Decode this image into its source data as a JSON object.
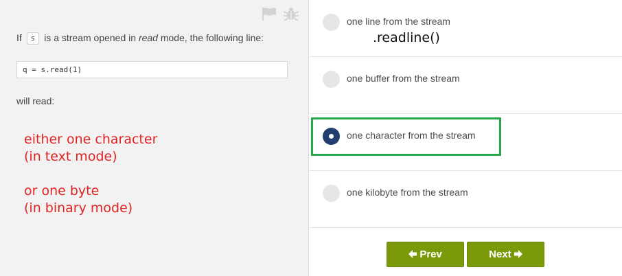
{
  "toolbar": {
    "flag_icon": "flag-icon",
    "bug_icon": "bug-icon"
  },
  "question": {
    "prefix": "If",
    "variable": "s",
    "middle": "is a stream opened in",
    "mode": "read",
    "suffix": "mode, the following line:",
    "code": "q = s.read(1)",
    "will_read": "will read:"
  },
  "annotations": {
    "note_1_line_1": "either one character",
    "note_1_line_2": "(in text mode)",
    "note_2_line_1": "or one byte",
    "note_2_line_2": "(in binary mode)"
  },
  "options": [
    {
      "label": "one line from the stream",
      "selected": false,
      "note": ".readline()"
    },
    {
      "label": "one buffer from the stream",
      "selected": false
    },
    {
      "label": "one character from the stream",
      "selected": true
    },
    {
      "label": "one kilobyte from the stream",
      "selected": false
    }
  ],
  "navigation": {
    "prev_label": "Prev",
    "next_label": "Next"
  },
  "colors": {
    "button_green": "#7a9a0a",
    "highlight_green": "#27a84a",
    "annotation_red": "#e02424",
    "selected_radio": "#213f6e"
  }
}
